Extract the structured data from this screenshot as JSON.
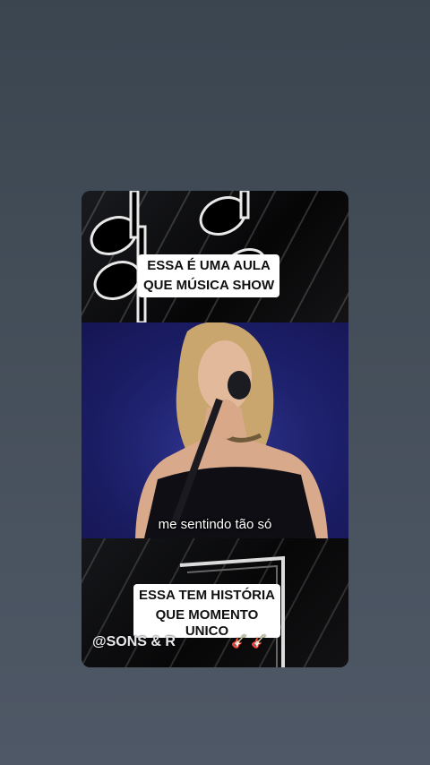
{
  "post": {
    "caption_top_line1": "ESSA É UMA AULA",
    "caption_top_line2": "QUE MÚSICA SHOW",
    "subtitle": "me sentindo tão só",
    "caption_bottom_line1": "ESSA TEM HISTÓRIA",
    "caption_bottom_line2": "QUE MOMENTO",
    "caption_bottom_line3": "ÚNICO",
    "watermark": "@SONS & R",
    "watermark_icons": [
      "guitar-icon",
      "guitar-icon"
    ]
  },
  "colors": {
    "background": "#444e59",
    "video_stage": "#1e2170",
    "caption_bg": "#ffffff"
  }
}
